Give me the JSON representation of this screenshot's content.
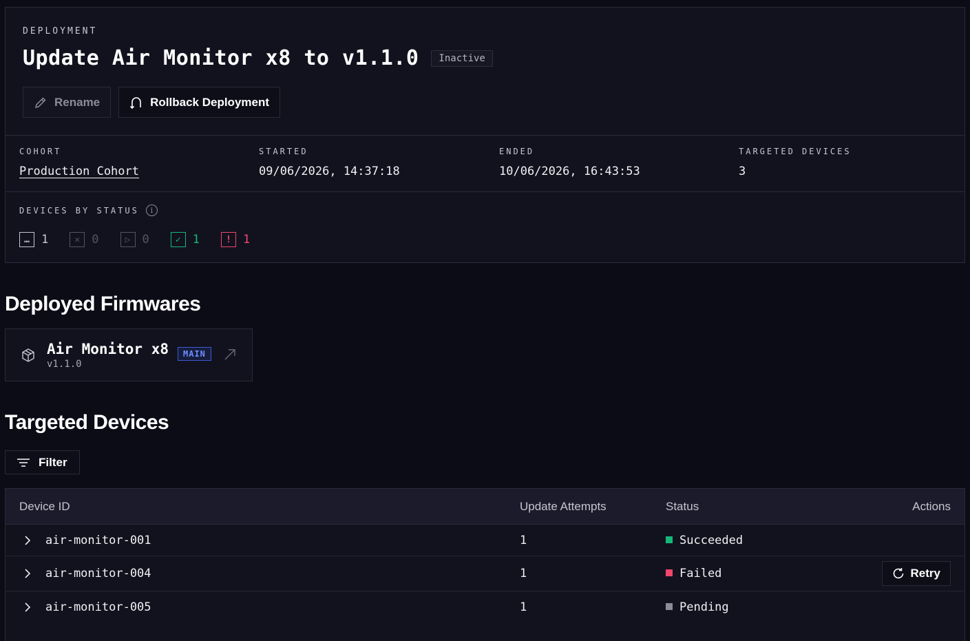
{
  "header": {
    "eyebrow": "DEPLOYMENT",
    "title": "Update Air Monitor x8 to v1.1.0",
    "status_badge": "Inactive",
    "actions": {
      "rename": "Rename",
      "rollback": "Rollback Deployment"
    }
  },
  "meta": {
    "cohort": {
      "label": "COHORT",
      "value": "Production Cohort"
    },
    "started": {
      "label": "STARTED",
      "value": "09/06/2026, 14:37:18"
    },
    "ended": {
      "label": "ENDED",
      "value": "10/06/2026, 16:43:53"
    },
    "targeted": {
      "label": "TARGETED DEVICES",
      "value": "3"
    }
  },
  "devices_by_status": {
    "label": "DEVICES BY STATUS",
    "counts": [
      {
        "icon": "pending-icon",
        "count": "1",
        "color": "#c8c8d2"
      },
      {
        "icon": "cancelled-icon",
        "count": "0",
        "color": "#55555f"
      },
      {
        "icon": "in-progress-icon",
        "count": "0",
        "color": "#55555f"
      },
      {
        "icon": "succeeded-icon",
        "count": "1",
        "color": "#16b87a"
      },
      {
        "icon": "failed-icon",
        "count": "1",
        "color": "#f0476b"
      }
    ]
  },
  "firmwares": {
    "heading": "Deployed Firmwares",
    "items": [
      {
        "name": "Air Monitor x8",
        "version": "v1.1.0",
        "tag": "MAIN"
      }
    ]
  },
  "devices": {
    "heading": "Targeted Devices",
    "filter_label": "Filter",
    "columns": {
      "device_id": "Device ID",
      "attempts": "Update Attempts",
      "status": "Status",
      "actions": "Actions"
    },
    "rows": [
      {
        "device_id": "air-monitor-001",
        "attempts": "1",
        "status": "Succeeded",
        "status_color": "#16b87a",
        "action": ""
      },
      {
        "device_id": "air-monitor-004",
        "attempts": "1",
        "status": "Failed",
        "status_color": "#f0476b",
        "action": "Retry"
      },
      {
        "device_id": "air-monitor-005",
        "attempts": "1",
        "status": "Pending",
        "status_color": "#8c8c98",
        "action": ""
      }
    ]
  }
}
